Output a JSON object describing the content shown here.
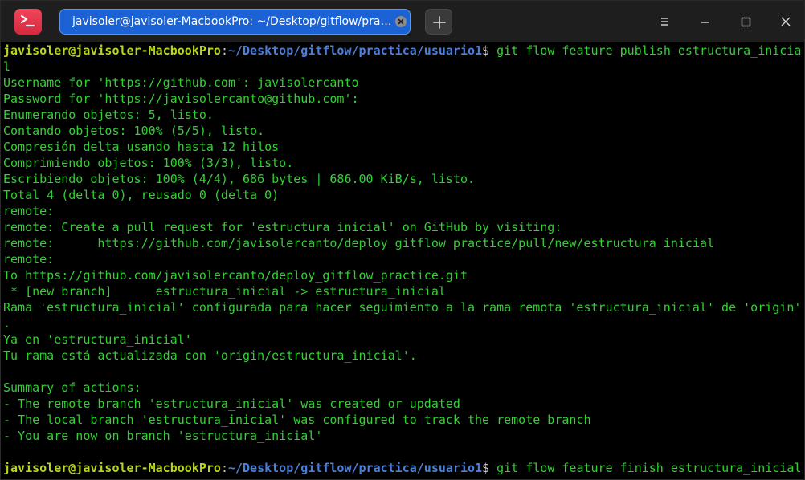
{
  "window": {
    "tab_title": "javisoler@javisoler-MacbookPro: ~/Desktop/gitflow/practica/..."
  },
  "icons": {
    "app": "terminal-app-icon",
    "tab_close": "close-icon",
    "new_tab": "plus-icon",
    "menu": "hamburger-menu-icon",
    "minimize": "minimize-icon",
    "maximize": "maximize-icon",
    "close": "close-icon"
  },
  "colors": {
    "prompt_user": "#bbd41e",
    "prompt_path": "#4b7fd8",
    "output_text": "#33d033",
    "tab_active": "#1c62d4",
    "background": "#000000"
  },
  "terminal": {
    "prompt": {
      "user_host": "javisoler@javisoler-MacbookPro",
      "separator": ":",
      "path": "~/Desktop/gitflow/practica/usuario1",
      "symbol": "$ "
    },
    "first_command": "git flow feature publish estructura_inicia",
    "first_command_wrap": "l",
    "output": [
      "Username for 'https://github.com': javisolercanto",
      "Password for 'https://javisolercanto@github.com':",
      "Enumerando objetos: 5, listo.",
      "Contando objetos: 100% (5/5), listo.",
      "Compresión delta usando hasta 12 hilos",
      "Comprimiendo objetos: 100% (3/3), listo.",
      "Escribiendo objetos: 100% (4/4), 686 bytes | 686.00 KiB/s, listo.",
      "Total 4 (delta 0), reusado 0 (delta 0)",
      "remote:",
      "remote: Create a pull request for 'estructura_inicial' on GitHub by visiting:",
      "remote:      https://github.com/javisolercanto/deploy_gitflow_practice/pull/new/estructura_inicial",
      "remote:",
      "To https://github.com/javisolercanto/deploy_gitflow_practice.git",
      " * [new branch]      estructura_inicial -> estructura_inicial",
      "Rama 'estructura_inicial' configurada para hacer seguimiento a la rama remota 'estructura_inicial' de 'origin'",
      ".",
      "Ya en 'estructura_inicial'",
      "Tu rama está actualizada con 'origin/estructura_inicial'.",
      "",
      "Summary of actions:",
      "- The remote branch 'estructura_inicial' was created or updated",
      "- The local branch 'estructura_inicial' was configured to track the remote branch",
      "- You are now on branch 'estructura_inicial'",
      ""
    ],
    "second_command": "git flow feature finish estructura_inicial"
  }
}
